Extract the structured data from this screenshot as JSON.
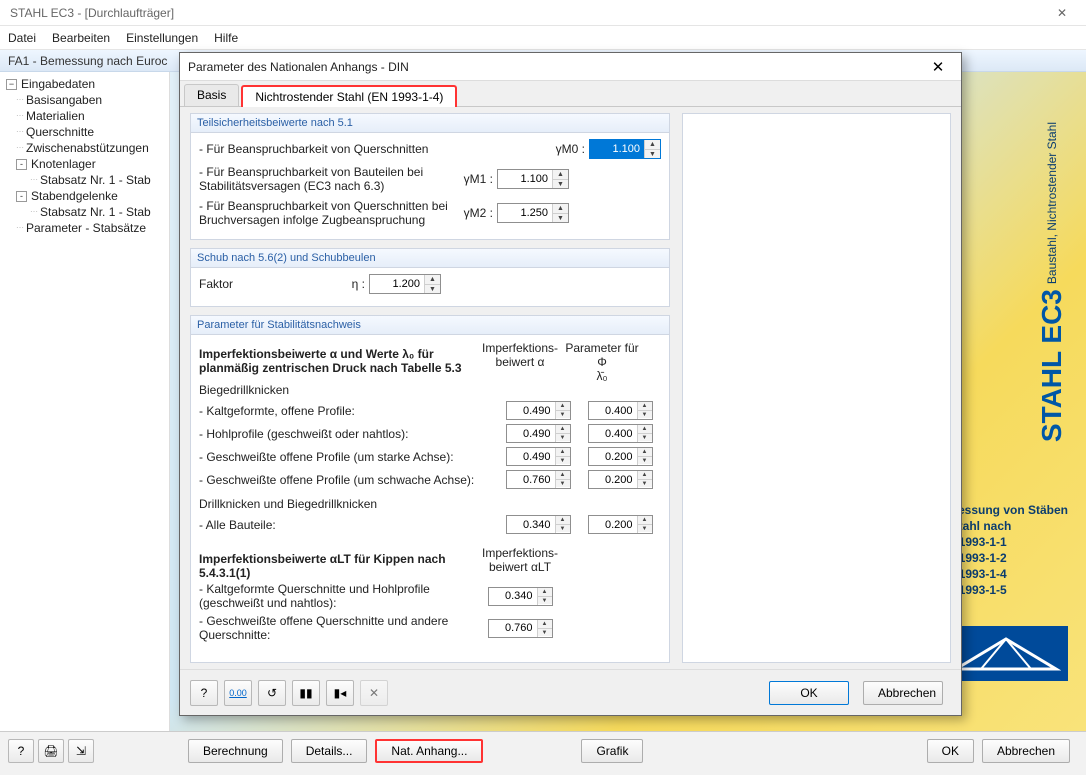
{
  "app": {
    "title": "STAHL EC3 - [Durchlaufträger]",
    "menu": [
      "Datei",
      "Bearbeiten",
      "Einstellungen",
      "Hilfe"
    ],
    "subtitle": "FA1 - Bemessung nach Euroc",
    "close_glyph": "✕"
  },
  "tree": {
    "root": "Eingabedaten",
    "items": [
      {
        "label": "Basisangaben",
        "indent": 1
      },
      {
        "label": "Materialien",
        "indent": 1
      },
      {
        "label": "Querschnitte",
        "indent": 1
      },
      {
        "label": "Zwischenabstützungen",
        "indent": 1
      },
      {
        "label": "Knotenlager",
        "indent": 1,
        "expand": "-"
      },
      {
        "label": "Stabsatz Nr. 1 - Stab",
        "indent": 2
      },
      {
        "label": "Stabendgelenke",
        "indent": 1,
        "expand": "-"
      },
      {
        "label": "Stabsatz Nr. 1 - Stab",
        "indent": 2
      },
      {
        "label": "Parameter - Stabsätze",
        "indent": 1
      }
    ]
  },
  "right": {
    "logo_main": "STAHL EC3",
    "logo_sub": "Baustahl, Nichtrostender Stahl",
    "blurb": [
      "nessung von Stäben",
      "Stahl nach",
      "1993-1-1",
      "1993-1-2",
      "1993-1-4",
      "1993-1-5"
    ]
  },
  "bottom": {
    "buttons": [
      "Berechnung",
      "Details...",
      "Nat. Anhang...",
      "Grafik"
    ],
    "ok": "OK",
    "cancel": "Abbrechen"
  },
  "dialog": {
    "title": "Parameter des Nationalen Anhangs - DIN",
    "tabs": [
      "Basis",
      "Nichtrostender Stahl (EN 1993-1-4)"
    ],
    "active_tab": 1,
    "group1": {
      "header": "Teilsicherheitsbeiwerte nach 5.1",
      "r1_label": "- Für Beanspruchbarkeit von Querschnitten",
      "r1_sym": "γM0 :",
      "r1_val": "1.100",
      "r2_label": "- Für Beanspruchbarkeit von Bauteilen bei Stabilitätsversagen (EC3 nach 6.3)",
      "r2_sym": "γM1 :",
      "r2_val": "1.100",
      "r3_label": "- Für Beanspruchbarkeit von Querschnitten bei Bruchversagen infolge Zugbeanspruchung",
      "r3_sym": "γM2 :",
      "r3_val": "1.250"
    },
    "group2": {
      "header": "Schub nach 5.6(2) und Schubbeulen",
      "label": "Faktor",
      "sym": "η :",
      "val": "1.200"
    },
    "group3": {
      "header": "Parameter für Stabilitätsnachweis",
      "intro1": "Imperfektionsbeiwerte α und Werte λ₀ für planmäßig zentrischen Druck nach Tabelle 5.3",
      "sub_biege": "Biegedrillknicken",
      "col_a": "Imperfektions-\nbeiwert α",
      "col_l": "Parameter für Φ\nλ̄₀",
      "rows_biege": [
        {
          "label": "- Kaltgeformte, offene Profile:",
          "a": "0.490",
          "l": "0.400"
        },
        {
          "label": "- Hohlprofile (geschweißt oder nahtlos):",
          "a": "0.490",
          "l": "0.400"
        },
        {
          "label": "- Geschweißte offene Profile (um starke Achse):",
          "a": "0.490",
          "l": "0.200"
        },
        {
          "label": "- Geschweißte offene Profile (um schwache Achse):",
          "a": "0.760",
          "l": "0.200"
        }
      ],
      "sub_drill": "Drillknicken und Biegedrillknicken",
      "row_all": {
        "label": "- Alle Bauteile:",
        "a": "0.340",
        "l": "0.200"
      },
      "intro2": "Imperfektionsbeiwerte αLT für Kippen nach 5.4.3.1(1)",
      "col_alt": "Imperfektions-\nbeiwert αLT",
      "rows_lt": [
        {
          "label": "- Kaltgeformte Querschnitte und Hohlprofile (geschweißt und nahtlos):",
          "a": "0.340"
        },
        {
          "label": "- Geschweißte offene Querschnitte und andere Querschnitte:",
          "a": "0.760"
        }
      ]
    },
    "footer": {
      "ok": "OK",
      "cancel": "Abbrechen"
    }
  }
}
